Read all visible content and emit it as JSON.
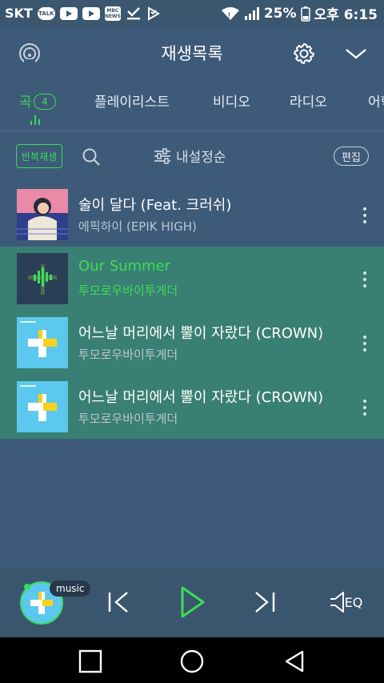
{
  "status_bar": {
    "carrier": "SKT",
    "talk_label": "TALK",
    "news_label": "MBC NEWS",
    "battery": "25%",
    "time": "오후 6:15"
  },
  "header": {
    "title": "재생목록"
  },
  "tabs": [
    {
      "label": "곡",
      "count": "4",
      "active": true
    },
    {
      "label": "플레이리스트"
    },
    {
      "label": "비디오"
    },
    {
      "label": "라디오"
    },
    {
      "label": "어학"
    }
  ],
  "toolbar": {
    "repeat_label": "반복재생",
    "sort_label": "내설정순",
    "edit_label": "편집"
  },
  "tracks": [
    {
      "title": "술이 달다 (Feat. 크러쉬)",
      "artist": "에픽하이 (EPIK HIGH)",
      "playing": false,
      "highlighted": false,
      "art": "illustration"
    },
    {
      "title": "Our Summer",
      "artist": "투모로우바이투게더",
      "playing": true,
      "highlighted": true,
      "art": "dark"
    },
    {
      "title": "어느날 머리에서 뿔이 자랐다 (CROWN)",
      "artist": "투모로우바이투게더",
      "playing": false,
      "highlighted": true,
      "art": "cyan"
    },
    {
      "title": "어느날 머리에서 뿔이 자랐다 (CROWN)",
      "artist": "투모로우바이투게더",
      "playing": false,
      "highlighted": true,
      "art": "cyan"
    }
  ],
  "player": {
    "badge": "music",
    "eq_label": "EQ"
  },
  "colors": {
    "accent": "#3ddc57",
    "background": "#3d5a79",
    "highlight_row": "#3a7f73"
  }
}
